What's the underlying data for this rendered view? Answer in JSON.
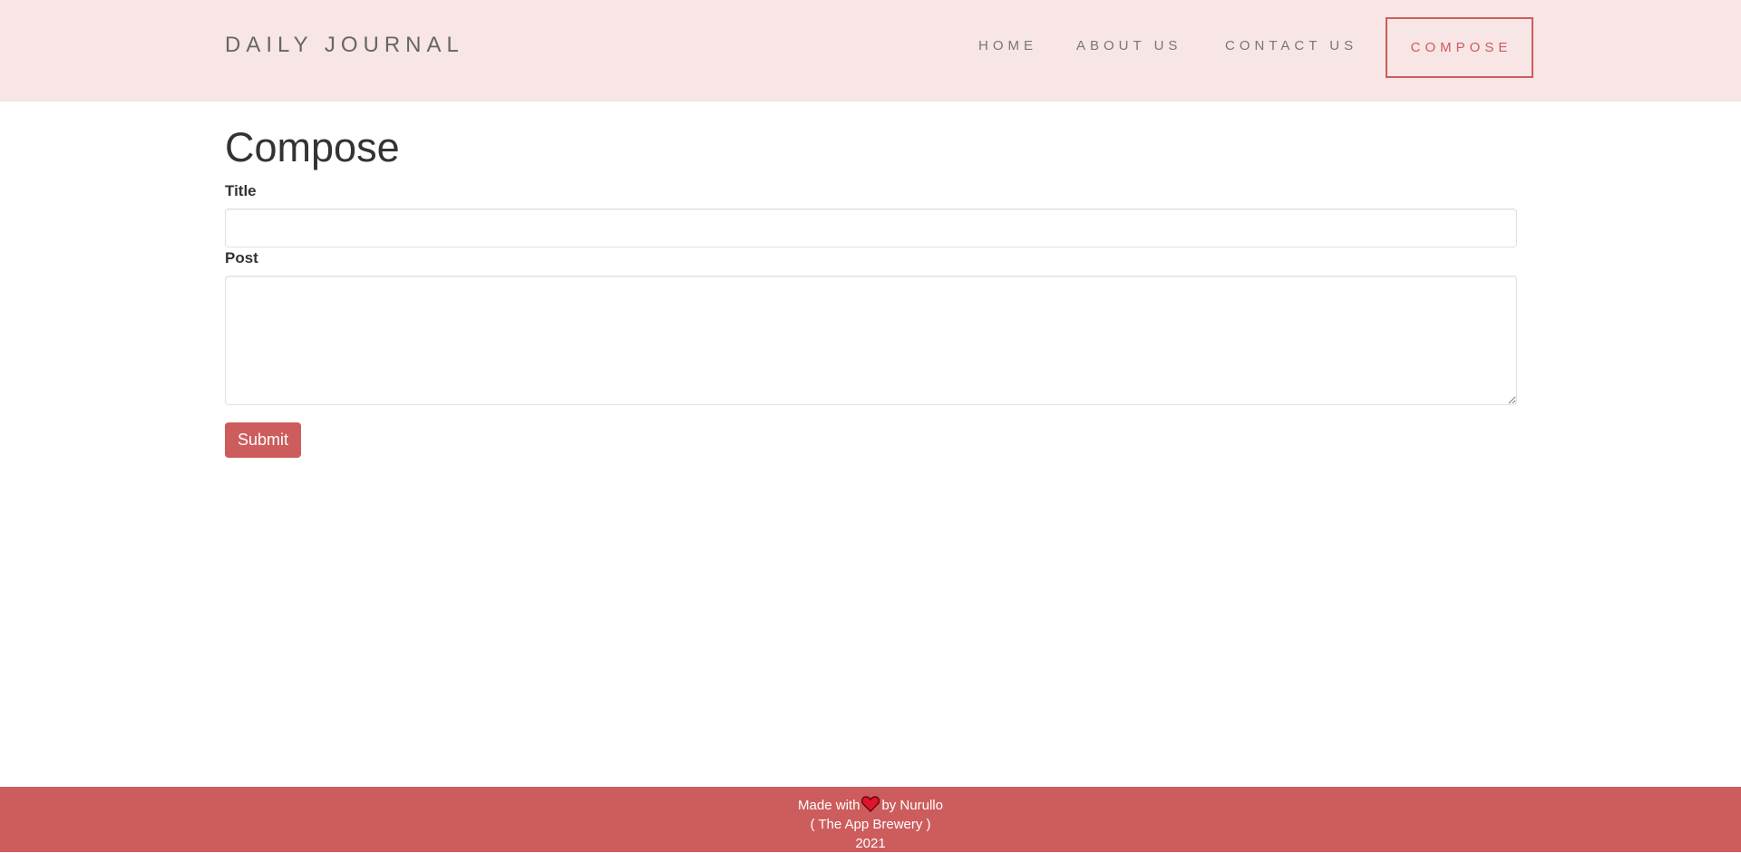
{
  "navbar": {
    "brand": "DAILY JOURNAL",
    "items": [
      {
        "label": "HOME"
      },
      {
        "label": "ABOUT US"
      },
      {
        "label": "CONTACT US"
      },
      {
        "label": "COMPOSE",
        "active": true
      }
    ]
  },
  "main": {
    "heading": "Compose",
    "title_label": "Title",
    "title_value": "",
    "post_label": "Post",
    "post_value": "",
    "submit_label": "Submit"
  },
  "footer": {
    "made_with": "Made with",
    "by": "by Nurullo",
    "org": "( The App Brewery )",
    "year": "2021",
    "heart_icon": "heart-icon"
  },
  "colors": {
    "navbar_bg": "#f8e5e5",
    "accent": "#cd5c5c",
    "heart": "#e0142d"
  }
}
